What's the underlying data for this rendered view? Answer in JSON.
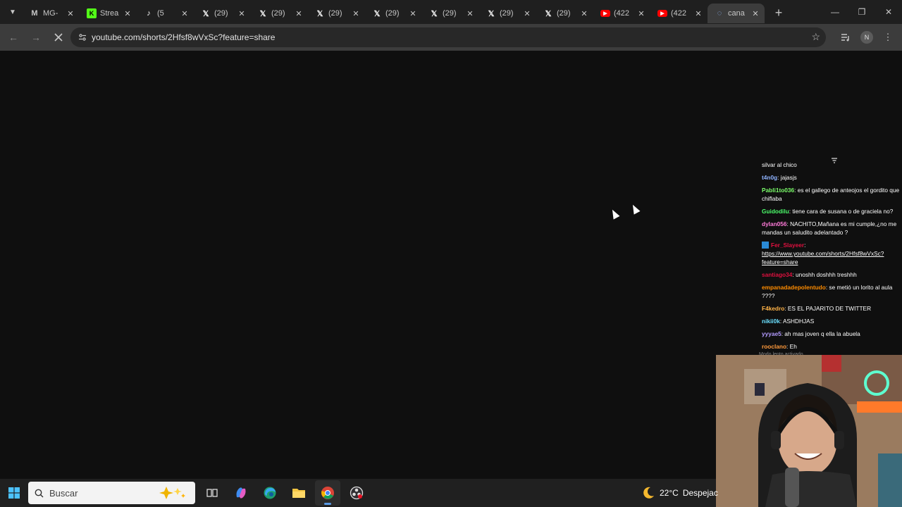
{
  "browser": {
    "tabs": [
      {
        "title": "MG-",
        "favicon": "mg-icon",
        "fav_color": "#c7c7c7",
        "active": false
      },
      {
        "title": "Strea",
        "favicon": "kick-icon",
        "fav_color": "#53fc18",
        "active": false
      },
      {
        "title": "(5",
        "favicon": "tiktok-icon",
        "fav_color": "#ffffff",
        "active": false
      },
      {
        "title": "(29)",
        "favicon": "x-icon",
        "fav_color": "#ffffff",
        "active": false
      },
      {
        "title": "(29)",
        "favicon": "x-icon",
        "fav_color": "#ffffff",
        "active": false
      },
      {
        "title": "(29)",
        "favicon": "x-icon",
        "fav_color": "#ffffff",
        "active": false
      },
      {
        "title": "(29)",
        "favicon": "x-icon",
        "fav_color": "#ffffff",
        "active": false
      },
      {
        "title": "(29)",
        "favicon": "x-icon",
        "fav_color": "#ffffff",
        "active": false
      },
      {
        "title": "(29)",
        "favicon": "x-icon",
        "fav_color": "#ffffff",
        "active": false
      },
      {
        "title": "(29)",
        "favicon": "x-icon",
        "fav_color": "#ffffff",
        "active": false
      },
      {
        "title": "(422",
        "favicon": "youtube-icon",
        "fav_color": "#ff0000",
        "active": false
      },
      {
        "title": "(422",
        "favicon": "youtube-icon",
        "fav_color": "#ff0000",
        "active": false
      },
      {
        "title": "cana",
        "favicon": "loading-icon",
        "fav_color": "#8ab4f8",
        "active": true
      }
    ],
    "url": "youtube.com/shorts/2Hfsf8wVxSc?feature=share",
    "profile_initial": "N"
  },
  "chat": {
    "messages": [
      {
        "user": "",
        "user_color": "#ffffff",
        "text": "silvar al chico"
      },
      {
        "user": "t4n0g",
        "user_color": "#8fb3ff",
        "text": ": jajasjs"
      },
      {
        "user": "Pabli1to036",
        "user_color": "#7cff6b",
        "text": ": es el gallego de anteojos el gordito que chiflaba"
      },
      {
        "user": "Guidodilu",
        "user_color": "#4cff6b",
        "text": ": tiene cara de susana o de graciela no?"
      },
      {
        "user": "dylan056",
        "user_color": "#ff7ad9",
        "text": ": NACHITO,Mañana es mi cumple,¿no me mandas un saludito adelantado ?"
      },
      {
        "user": "Fer_Slayeer",
        "user_color": "#e0103f",
        "text": ":",
        "link": "https://www.youtube.com/shorts/2Hfsf8wVxSc?feature=share",
        "badge": true
      },
      {
        "user": "santiago34",
        "user_color": "#e0103f",
        "text": ": unoshh doshhh treshhh"
      },
      {
        "user": "empanadadepolentudo",
        "user_color": "#ff8c00",
        "text": ": se metió un lorito al aula ????"
      },
      {
        "user": "F4kedro",
        "user_color": "#ffb347",
        "text": ": ES EL PAJARITO DE TWITTER"
      },
      {
        "user": "nikii0k",
        "user_color": "#6be0ff",
        "text": ": ASHDHJAS"
      },
      {
        "user": "yyyae5",
        "user_color": "#b39bff",
        "text": ": ah mas joven q ella la abuela"
      },
      {
        "user": "rooclano",
        "user_color": "#ff9a3c",
        "text": ": Eh"
      }
    ],
    "footer": "Modo lento activado"
  },
  "taskbar": {
    "search_placeholder": "Buscar",
    "apps": [
      "task-view-icon",
      "copilot-icon",
      "edge-icon",
      "file-explorer-icon",
      "chrome-icon",
      "obs-icon"
    ],
    "active_app": "chrome-icon",
    "weather_temp": "22°C",
    "weather_desc": "Despejac"
  }
}
